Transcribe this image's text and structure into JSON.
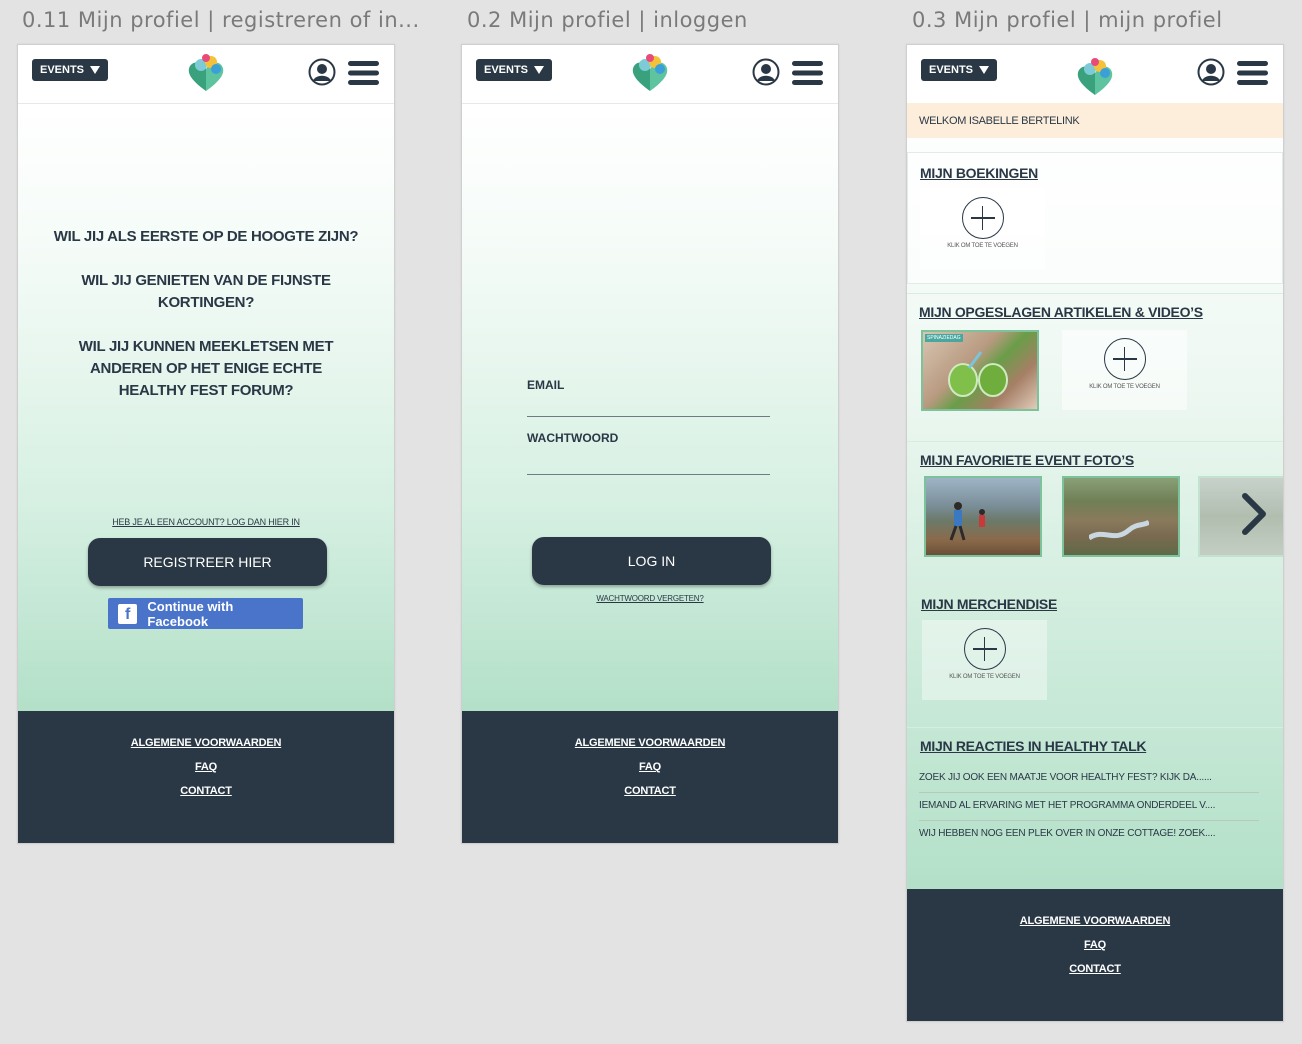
{
  "artboards": [
    {
      "title": "0.11 Mijn profiel | registreren of in..."
    },
    {
      "title": "0.2 Mijn profiel | inloggen"
    },
    {
      "title": "0.3 Mijn profiel | mijn profiel"
    }
  ],
  "header": {
    "events_label": "EVENTS"
  },
  "footer": {
    "terms": "ALGEMENE VOORWAARDEN",
    "faq": "FAQ",
    "contact": "CONTACT"
  },
  "register": {
    "question1": "WIL JIJ ALS EERSTE OP DE HOOGTE ZIJN?",
    "question2": "WIL JIJ GENIETEN VAN DE FIJNSTE KORTINGEN?",
    "question3": "WIL JIJ KUNNEN MEEKLETSEN MET ANDEREN OP HET ENIGE ECHTE HEALTHY FEST FORUM?",
    "login_link": "HEB JE AL EEN ACCOUNT? LOG DAN HIER IN",
    "register_button": "REGISTREER HIER",
    "facebook_button": "Continue with Facebook"
  },
  "login": {
    "email_label": "EMAIL",
    "password_label": "WACHTWOORD",
    "login_button": "LOG IN",
    "forgot_link": "WACHTWOORD VERGETEN?"
  },
  "profile": {
    "welcome": "WELKOM ISABELLE BERTELINK",
    "bookings_title": "MIJN BOEKINGEN",
    "add_caption": "KLIK OM TOE TE VOEGEN",
    "saved_title": "MIJN OPGESLAGEN ARTIKELEN & VIDEO’S",
    "saved_tag": "SPINAZIEDAG",
    "photos_title": "MIJN FAVORIETE EVENT FOTO’S",
    "merch_title": "MIJN MERCHENDISE",
    "reactions_title": "MIJN REACTIES IN HEALTHY TALK",
    "reactions": [
      "ZOEK JIJ OOK EEN MAATJE VOOR HEALTHY FEST? KIJK DA......",
      "IEMAND AL ERVARING MET HET PROGRAMMA ONDERDEEL V....",
      "WIJ HEBBEN NOG EEN PLEK OVER IN ONZE COTTAGE! ZOEK...."
    ]
  },
  "colors": {
    "navy": "#2a3846",
    "mint": "#b3e0c8",
    "welcome_bg": "#fdeedc",
    "facebook": "#4a74c9"
  }
}
